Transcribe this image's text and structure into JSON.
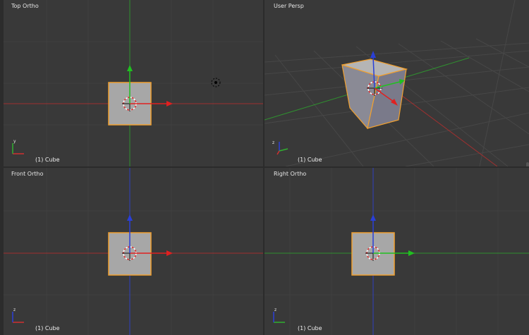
{
  "viewports": {
    "top_left": {
      "title": "Top Ortho",
      "object_label": "(1) Cube"
    },
    "top_right": {
      "title": "User Persp",
      "object_label": "(1) Cube"
    },
    "bottom_left": {
      "title": "Front Ortho",
      "object_label": "(1) Cube"
    },
    "bottom_right": {
      "title": "Right Ortho",
      "object_label": "(1) Cube"
    }
  },
  "axis_indicator": {
    "y_label": "y",
    "z_label": "z"
  },
  "colors": {
    "viewport_bg": "#393939",
    "grid": "#404040",
    "x_axis": "#c03030",
    "y_axis": "#30a030",
    "z_axis": "#2a3fd8",
    "cube_fill": "#a7a7a7",
    "cube_outline": "#f0a030",
    "cursor_ring": "#e03030"
  },
  "icons": {
    "cursor": "3d-cursor-icon",
    "lamp": "lamp-icon"
  }
}
